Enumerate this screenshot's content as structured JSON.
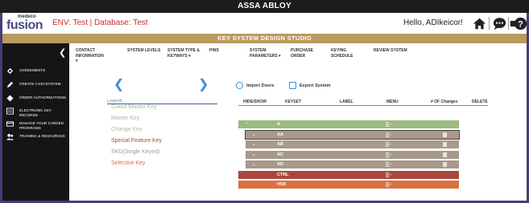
{
  "topbar": {
    "title": "ASSA ABLOY"
  },
  "header": {
    "logo_top": "medeco",
    "logo_main": "fusion",
    "env": "ENV: Test | Database: Test",
    "greeting": "Hello, ADIkeicor!"
  },
  "banner": {
    "title": "KEY SYSTEM DESIGN STUDIO"
  },
  "sidebar": {
    "items": [
      {
        "label": "AGREEMENTS",
        "icon": "handshake-icon"
      },
      {
        "label": "CREATE A KEYSYSTEM",
        "icon": "pencil-icon"
      },
      {
        "label": "ORDER AUTHORIZATIONS",
        "icon": "diamond-icon"
      },
      {
        "label": "ELECTRONIC KEY RECORDS",
        "icon": "list-icon"
      },
      {
        "label": "MANAGE YOUR CARDED PROGRAMS",
        "icon": "card-icon"
      },
      {
        "label": "TRAINING & RESOURCES",
        "icon": "people-icon"
      }
    ]
  },
  "nav": {
    "items": [
      "CONTACT INFORMATION",
      "SYSTEM LEVELS",
      "SYSTEM TYPE & KEYWAYS",
      "PINS",
      "SYSTEM PARAMETERS",
      "PURCHASE ORDER",
      "KEYING SCHEDULE",
      "REVIEW SYSTEM"
    ]
  },
  "legend": {
    "title": "Legend",
    "items": [
      {
        "label": "Grand Master Key",
        "color": "#a8b98a"
      },
      {
        "label": "Master Key",
        "color": "#b0b0b0"
      },
      {
        "label": "Change Key",
        "color": "#c4b59a"
      },
      {
        "label": "Special Feature Key",
        "color": "#a9493c"
      },
      {
        "label": "SKD(Single Keyed)",
        "color": "#9a9a9a"
      },
      {
        "label": "Selective Key",
        "color": "#d9713f"
      }
    ]
  },
  "actions": {
    "import": "Import Doors",
    "export": "Export System"
  },
  "table": {
    "headers": [
      "HIDE/SHOW",
      "KEYSET",
      "LABEL",
      "MENU",
      "# OF Changes",
      "DELETE"
    ],
    "rows": [
      {
        "keyset": "A",
        "color": "#9cb97f",
        "level": 0,
        "chevron": "^"
      },
      {
        "keyset": "AA",
        "color": "#a8998a",
        "level": 1,
        "chevron": "v"
      },
      {
        "keyset": "AB",
        "color": "#a8998a",
        "level": 1,
        "chevron": "v"
      },
      {
        "keyset": "AC",
        "color": "#a8998a",
        "level": 1,
        "chevron": "v"
      },
      {
        "keyset": "AD",
        "color": "#a8998a",
        "level": 1,
        "chevron": "v"
      },
      {
        "keyset": "CTRL",
        "color": "#a9493c",
        "level": 0,
        "chevron": ""
      },
      {
        "keyset": "HSK",
        "color": "#d9713f",
        "level": 0,
        "chevron": ""
      }
    ]
  }
}
